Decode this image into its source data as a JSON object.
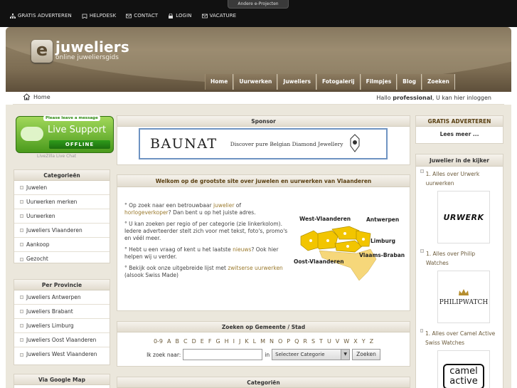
{
  "topbar": {
    "other_projects": "Andere e-Projecten",
    "links": [
      {
        "label": "GRATIS ADVERTEREN",
        "icon": "sitemap-icon"
      },
      {
        "label": "HELPDESK",
        "icon": "bookmark-icon"
      },
      {
        "label": "CONTACT",
        "icon": "envelope-icon"
      },
      {
        "label": "LOGIN",
        "icon": "lock-icon"
      },
      {
        "label": "VACATURE",
        "icon": "envelope-icon"
      }
    ]
  },
  "logo": {
    "letter": "e",
    "brand": "juweliers",
    "tagline": "online juweliersgids"
  },
  "mainnav": [
    "Home",
    "Uurwerken",
    "Juweliers",
    "Fotogalerij",
    "Filmpjes",
    "Blog",
    "Zoeken"
  ],
  "breadcrumb": {
    "home": "Home"
  },
  "greeting": {
    "prefix": "Hallo ",
    "user": "professional",
    "mid": ", U kan ",
    "link": "hier inloggen"
  },
  "livesupport": {
    "tag": "Please leave a message",
    "title": "Live Support",
    "status": "OFFLINE",
    "caption": "LiveZilla Live Chat"
  },
  "categories": {
    "title": "Categorieën",
    "items": [
      "Juwelen",
      "Uurwerken merken",
      "Uurwerken",
      "Juweliers Vlaanderen",
      "Aankoop",
      "Gezocht"
    ]
  },
  "provinces": {
    "title": "Per Provincie",
    "items": [
      "Juweliers Antwerpen",
      "Juweliers Brabant",
      "Juweliers Limburg",
      "Juweliers Oost Vlaanderen",
      "Juweliers West Vlaanderen"
    ]
  },
  "googlemap": {
    "title": "Via Google Map"
  },
  "sponsor": {
    "title": "Sponsor",
    "brand": "BAUNAT",
    "slogan": "Discover pure Belgian Diamond Jewellery"
  },
  "welcome": {
    "title": "Welkom op de grootste site over juwelen en uurwerken van Vlaanderen",
    "p1_a": "Op zoek naar een betrouwbaar ",
    "p1_link1": "juwelier",
    "p1_b": " of ",
    "p1_link2": "horlogeverkoper",
    "p1_c": "? Dan bent u op het juiste adres.",
    "p2": "U kan zoeken per regio of per categorie (zie linkerkolom). Iedere adverteerder stelt zich voor met tekst, foto's, promo's en véél meer.",
    "p3_a": "Hebt u een vraag of kent u het laatste ",
    "p3_link": "nieuws",
    "p3_b": "? Ook hier helpen wij u verder.",
    "p4_a": "Bekijk ook onze uitgebreide lijst met ",
    "p4_link": "zwitserse uurwerken",
    "p4_b": " (alsook Swiss Made)",
    "map_labels": {
      "west": "West-Vlaanderen",
      "antwerpen": "Antwerpen",
      "limburg": "Limburg",
      "brabant": "Vlaams-Brabant",
      "oost": "Oost-Vlaanderen"
    }
  },
  "search": {
    "title": "Zoeken op Gemeente / Stad",
    "letters": [
      "0-9",
      "A",
      "B",
      "C",
      "D",
      "E",
      "F",
      "G",
      "H",
      "I",
      "J",
      "K",
      "L",
      "M",
      "N",
      "O",
      "P",
      "Q",
      "R",
      "S",
      "T",
      "U",
      "V",
      "W",
      "X",
      "Y",
      "Z"
    ],
    "label": "Ik zoek naar:",
    "in": "in",
    "select_value": "Selecteer Categorie",
    "button": "Zoeken"
  },
  "categorien_bottom": {
    "title": "Categoriën"
  },
  "gratis": {
    "title": "GRATIS ADVERTEREN",
    "more": "Lees meer ..."
  },
  "kijker": {
    "title": "Juwelier in de kijker",
    "items": [
      {
        "label": "1. Alles over Urwerk uurwerken",
        "logo": "URWERK"
      },
      {
        "label": "1. Alles over Philip Watches",
        "logo": "PHILIPWATCH"
      },
      {
        "label": "1. Alles over Camel Active Swiss Watches",
        "logo": "camel active"
      }
    ]
  }
}
